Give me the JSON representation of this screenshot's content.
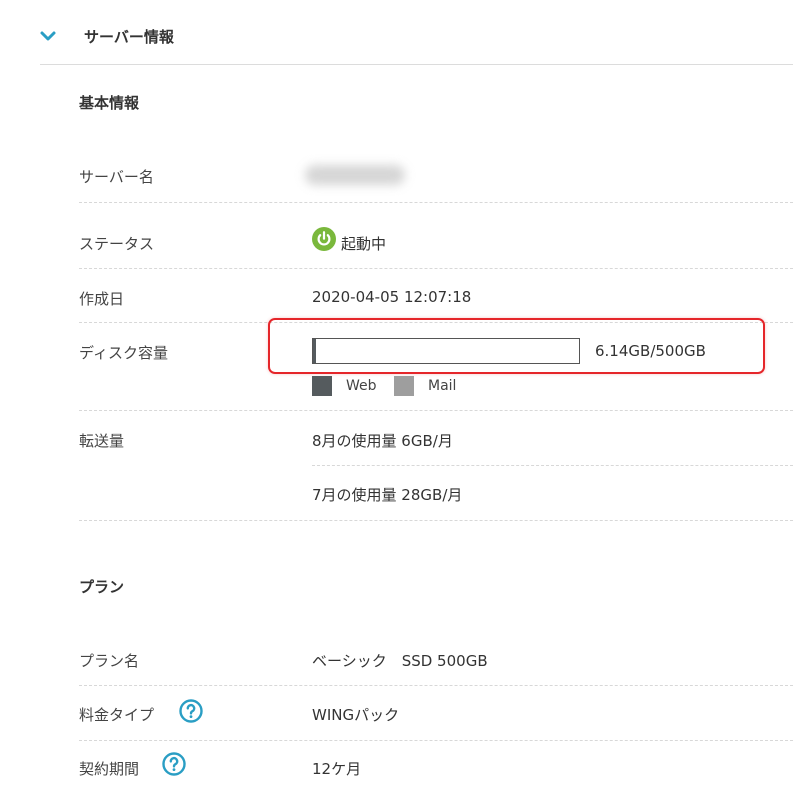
{
  "section": {
    "title": "サーバー情報"
  },
  "basic_info": {
    "title": "基本情報",
    "rows": {
      "server_name": {
        "label": "サーバー名"
      },
      "status": {
        "label": "ステータス",
        "value": "起動中",
        "icon": "power-icon",
        "icon_color": "#7ab83c"
      },
      "created": {
        "label": "作成日",
        "value": "2020-04-05 12:07:18"
      },
      "disk": {
        "label": "ディスク容量",
        "usage_text": "6.14GB/500GB",
        "used_gb": 6.14,
        "total_gb": 500,
        "legend": {
          "web": "Web",
          "mail": "Mail"
        },
        "web_color": "#555b5e",
        "mail_color": "#9e9e9e"
      },
      "transfer": {
        "label": "転送量",
        "aug": "8月の使用量 6GB/月",
        "jul": "7月の使用量 28GB/月"
      }
    }
  },
  "plan": {
    "title": "プラン",
    "rows": {
      "plan_name": {
        "label": "プラン名",
        "value": "ベーシック　SSD 500GB"
      },
      "fee_type": {
        "label": "料金タイプ",
        "value": "WINGパック",
        "help_icon": "question-circle-icon"
      },
      "contract": {
        "label": "契約期間",
        "value": "12ケ月",
        "help_icon": "question-circle-icon"
      }
    }
  },
  "colors": {
    "accent": "#2a9ec4",
    "highlight": "#e5262a"
  }
}
